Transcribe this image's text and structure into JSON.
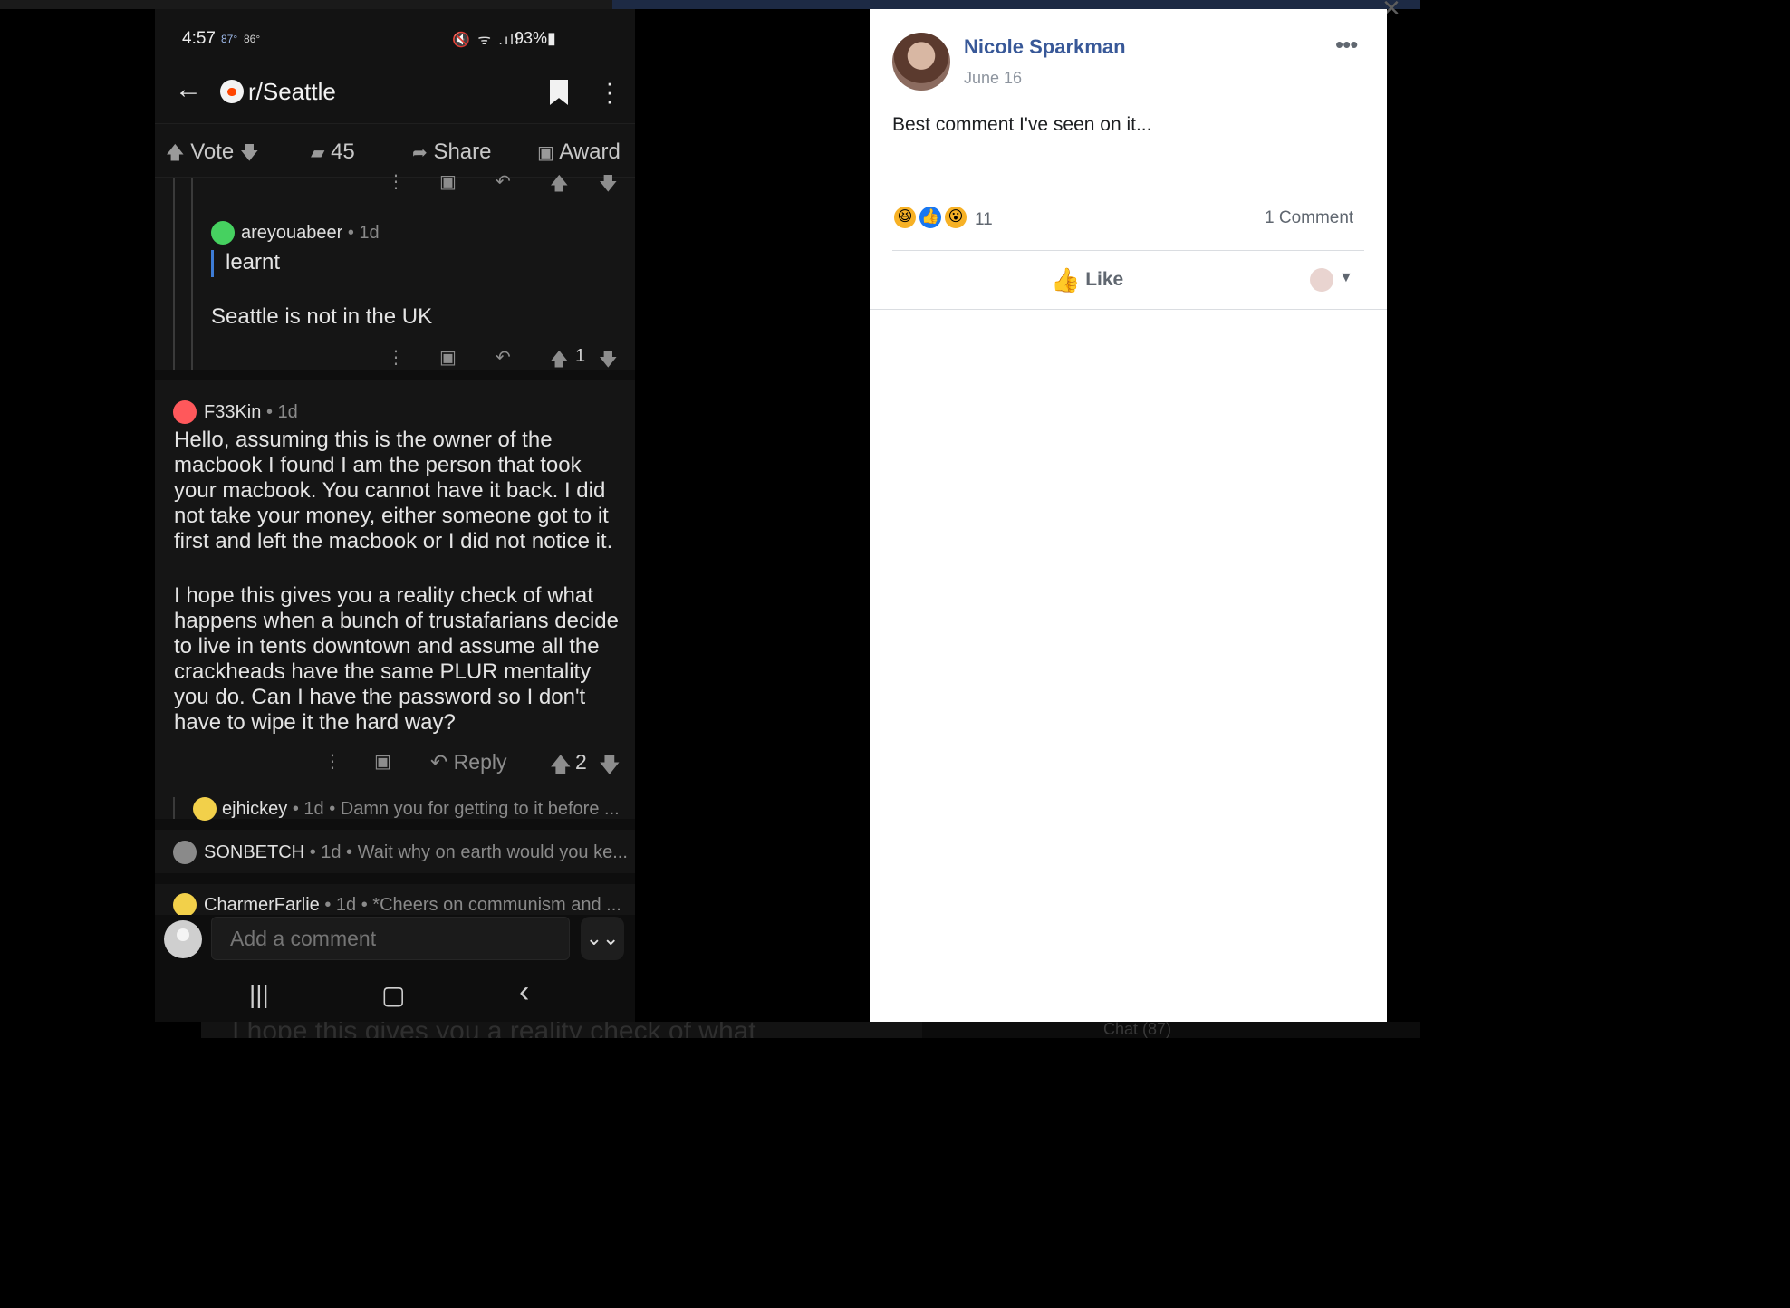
{
  "phone": {
    "status": {
      "time": "4:57",
      "temp_current": "87°",
      "temp_alt": "86°",
      "icons": "🔇 ᯤ .ıll",
      "battery": "93%▮"
    },
    "appbar": {
      "back_icon": "←",
      "subreddit": "r/Seattle",
      "overflow_icon": "⋮"
    },
    "actions": {
      "vote": "Vote",
      "comments": "45",
      "share": "Share",
      "award": "Award"
    },
    "comments": [
      {
        "author": "areyouabeer",
        "meta": "• 1d",
        "quote": "learnt",
        "body": "Seattle is not in the UK",
        "score": "1"
      },
      {
        "author": "F33Kin",
        "meta": "• 1d",
        "body_p1": "Hello, assuming this is the owner of the macbook I found I am the person that took your macbook. You cannot have it back. I did not take your money, either someone got to it first and left the macbook or I did not notice it.",
        "body_p2": "I hope this gives you a reality check of what happens when a bunch of trustafarians decide to live in tents downtown and assume all the crackheads have the same PLUR mentality you do. Can I have the password so I don't have to wipe it the hard way?",
        "reply_label": "Reply",
        "score": "2"
      }
    ],
    "collapsed": [
      {
        "author": "ejhickey",
        "meta": "• 1d • Damn you for getting to it before ..."
      },
      {
        "author": "SONBETCH",
        "meta": "• 1d • Wait why on earth would you ke..."
      },
      {
        "author": "CharmerFarlie",
        "meta": "• 1d • *Cheers on communism and ..."
      }
    ],
    "composer": {
      "placeholder": "Add a comment",
      "jump_icon": "⌄⌄"
    },
    "navbar": {
      "recents": "|||",
      "home": "▢",
      "back": "‹"
    }
  },
  "facebook": {
    "author": "Nicole Sparkman",
    "date": "June 16",
    "more_icon": "•••",
    "text": "Best comment I've seen on it...",
    "reaction_count": "11",
    "comment_count": "1 Comment",
    "like_label": "Like",
    "like_icon": "👍",
    "caret": "▼"
  },
  "background": {
    "ghost_text": "I hope this gives you a reality check of what",
    "chat_label": "Chat (87)"
  }
}
